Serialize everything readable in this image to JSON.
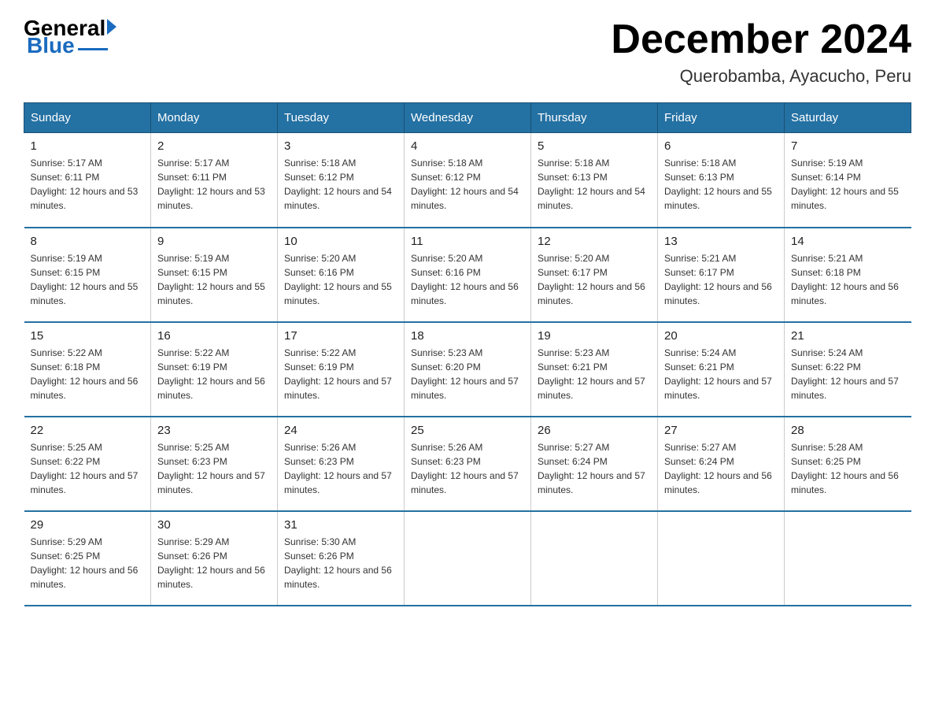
{
  "logo": {
    "general": "General",
    "blue": "Blue"
  },
  "title": "December 2024",
  "location": "Querobamba, Ayacucho, Peru",
  "days_of_week": [
    "Sunday",
    "Monday",
    "Tuesday",
    "Wednesday",
    "Thursday",
    "Friday",
    "Saturday"
  ],
  "weeks": [
    [
      {
        "day": "1",
        "sunrise": "5:17 AM",
        "sunset": "6:11 PM",
        "daylight": "12 hours and 53 minutes."
      },
      {
        "day": "2",
        "sunrise": "5:17 AM",
        "sunset": "6:11 PM",
        "daylight": "12 hours and 53 minutes."
      },
      {
        "day": "3",
        "sunrise": "5:18 AM",
        "sunset": "6:12 PM",
        "daylight": "12 hours and 54 minutes."
      },
      {
        "day": "4",
        "sunrise": "5:18 AM",
        "sunset": "6:12 PM",
        "daylight": "12 hours and 54 minutes."
      },
      {
        "day": "5",
        "sunrise": "5:18 AM",
        "sunset": "6:13 PM",
        "daylight": "12 hours and 54 minutes."
      },
      {
        "day": "6",
        "sunrise": "5:18 AM",
        "sunset": "6:13 PM",
        "daylight": "12 hours and 55 minutes."
      },
      {
        "day": "7",
        "sunrise": "5:19 AM",
        "sunset": "6:14 PM",
        "daylight": "12 hours and 55 minutes."
      }
    ],
    [
      {
        "day": "8",
        "sunrise": "5:19 AM",
        "sunset": "6:15 PM",
        "daylight": "12 hours and 55 minutes."
      },
      {
        "day": "9",
        "sunrise": "5:19 AM",
        "sunset": "6:15 PM",
        "daylight": "12 hours and 55 minutes."
      },
      {
        "day": "10",
        "sunrise": "5:20 AM",
        "sunset": "6:16 PM",
        "daylight": "12 hours and 55 minutes."
      },
      {
        "day": "11",
        "sunrise": "5:20 AM",
        "sunset": "6:16 PM",
        "daylight": "12 hours and 56 minutes."
      },
      {
        "day": "12",
        "sunrise": "5:20 AM",
        "sunset": "6:17 PM",
        "daylight": "12 hours and 56 minutes."
      },
      {
        "day": "13",
        "sunrise": "5:21 AM",
        "sunset": "6:17 PM",
        "daylight": "12 hours and 56 minutes."
      },
      {
        "day": "14",
        "sunrise": "5:21 AM",
        "sunset": "6:18 PM",
        "daylight": "12 hours and 56 minutes."
      }
    ],
    [
      {
        "day": "15",
        "sunrise": "5:22 AM",
        "sunset": "6:18 PM",
        "daylight": "12 hours and 56 minutes."
      },
      {
        "day": "16",
        "sunrise": "5:22 AM",
        "sunset": "6:19 PM",
        "daylight": "12 hours and 56 minutes."
      },
      {
        "day": "17",
        "sunrise": "5:22 AM",
        "sunset": "6:19 PM",
        "daylight": "12 hours and 57 minutes."
      },
      {
        "day": "18",
        "sunrise": "5:23 AM",
        "sunset": "6:20 PM",
        "daylight": "12 hours and 57 minutes."
      },
      {
        "day": "19",
        "sunrise": "5:23 AM",
        "sunset": "6:21 PM",
        "daylight": "12 hours and 57 minutes."
      },
      {
        "day": "20",
        "sunrise": "5:24 AM",
        "sunset": "6:21 PM",
        "daylight": "12 hours and 57 minutes."
      },
      {
        "day": "21",
        "sunrise": "5:24 AM",
        "sunset": "6:22 PM",
        "daylight": "12 hours and 57 minutes."
      }
    ],
    [
      {
        "day": "22",
        "sunrise": "5:25 AM",
        "sunset": "6:22 PM",
        "daylight": "12 hours and 57 minutes."
      },
      {
        "day": "23",
        "sunrise": "5:25 AM",
        "sunset": "6:23 PM",
        "daylight": "12 hours and 57 minutes."
      },
      {
        "day": "24",
        "sunrise": "5:26 AM",
        "sunset": "6:23 PM",
        "daylight": "12 hours and 57 minutes."
      },
      {
        "day": "25",
        "sunrise": "5:26 AM",
        "sunset": "6:23 PM",
        "daylight": "12 hours and 57 minutes."
      },
      {
        "day": "26",
        "sunrise": "5:27 AM",
        "sunset": "6:24 PM",
        "daylight": "12 hours and 57 minutes."
      },
      {
        "day": "27",
        "sunrise": "5:27 AM",
        "sunset": "6:24 PM",
        "daylight": "12 hours and 56 minutes."
      },
      {
        "day": "28",
        "sunrise": "5:28 AM",
        "sunset": "6:25 PM",
        "daylight": "12 hours and 56 minutes."
      }
    ],
    [
      {
        "day": "29",
        "sunrise": "5:29 AM",
        "sunset": "6:25 PM",
        "daylight": "12 hours and 56 minutes."
      },
      {
        "day": "30",
        "sunrise": "5:29 AM",
        "sunset": "6:26 PM",
        "daylight": "12 hours and 56 minutes."
      },
      {
        "day": "31",
        "sunrise": "5:30 AM",
        "sunset": "6:26 PM",
        "daylight": "12 hours and 56 minutes."
      },
      null,
      null,
      null,
      null
    ]
  ]
}
